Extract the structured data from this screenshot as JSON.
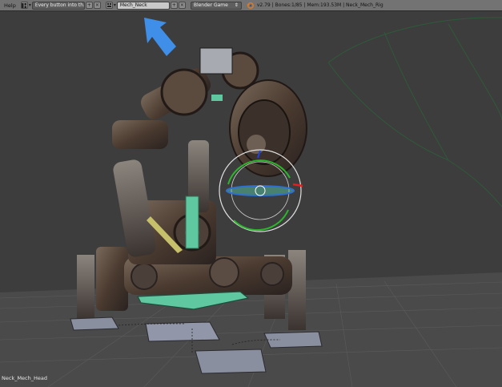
{
  "header": {
    "menu_help": "Help",
    "screen_layout": "Every button into th...",
    "scene_name": "Mech_Neck",
    "render_engine": "Blender Game",
    "info": "v2.79 | Bones:1/85 | Mem:193.53M | Neck_Mech_Rig"
  },
  "viewport": {
    "active_object_label": "Neck_Mech_Head"
  },
  "colors": {
    "header_bg": "#737373",
    "viewport_bg": "#3d3d3d",
    "floor": "#4a4a4a",
    "bone_green": "#5fc8a0",
    "arrow_blue": "#3f8ee8"
  },
  "icons": [
    "layout-icon",
    "scene-icon",
    "add-icon",
    "close-icon",
    "blender-logo-icon",
    "dropdown-arrow-icon"
  ]
}
